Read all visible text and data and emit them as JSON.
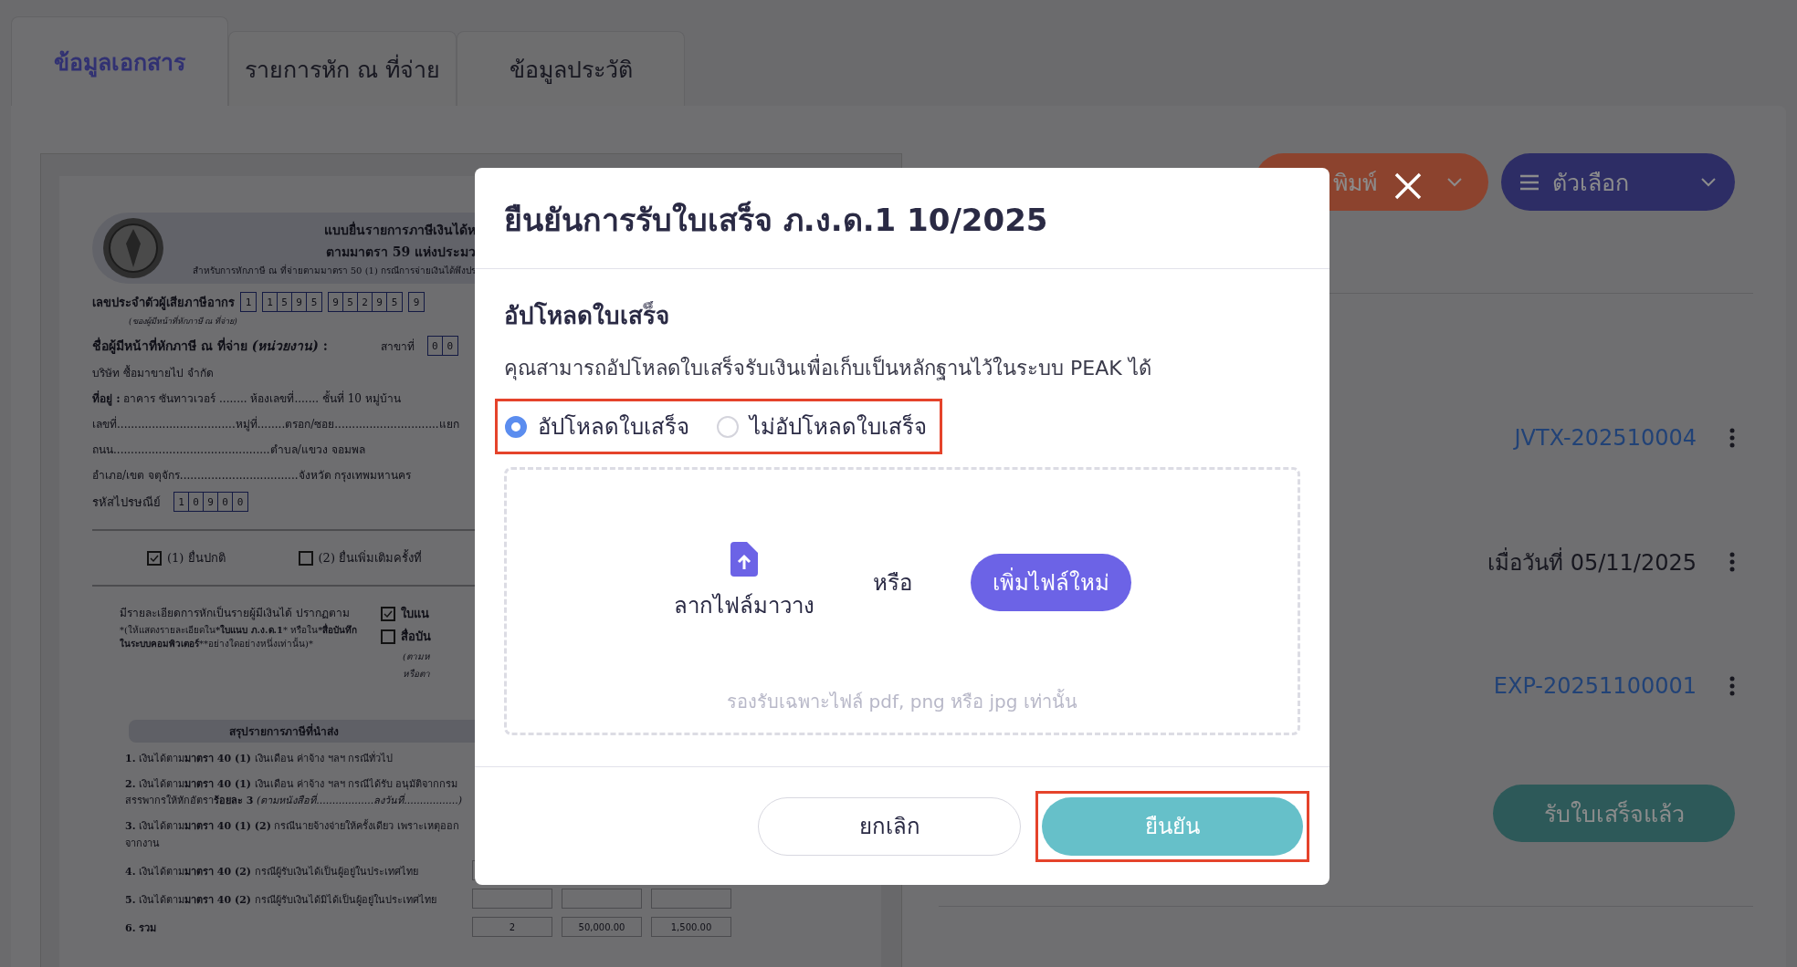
{
  "tabs": [
    {
      "label": "ข้อมูลเอกสาร",
      "selected": true
    },
    {
      "label": "รายการหัก ณ ที่จ่าย",
      "selected": false
    },
    {
      "label": "ข้อมูลประวัติ",
      "selected": false
    }
  ],
  "document": {
    "header": [
      "แบบยื่นรายการภาษีเงินได้ห",
      "ตามมาตรา 59 แห่งประมว",
      "สำหรับการหักภาษี ณ ที่จ่ายตามมาตรา 50 (1) กรณีการจ่ายเงินได้พึงปร"
    ],
    "tax_id_label": "เลขประจำตัวผู้เสียภาษีอากร",
    "tax_id_note": "(ของผู้มีหน้าที่หักภาษี ณ ที่จ่าย)",
    "tax_id_groups": [
      [
        "1"
      ],
      [
        "1",
        "5",
        "9",
        "5"
      ],
      [
        "9",
        "5",
        "2",
        "9",
        "5"
      ],
      [
        "9"
      ]
    ],
    "payer_label": "ชื่อผู้มีหน้าที่หักภาษี ณ ที่จ่าย *(หน่วยงาน)* :",
    "branch_label": "สาขาที่",
    "branch_digits": [
      "0",
      "0"
    ],
    "payer_name": "บริษัท ซื้อมาขายไป จำกัด",
    "address_lines": [
      "**ที่อยู่ :** อาคาร ซันทาวเวอร์ ........ ห้องเลขที่....... ชั้นที่ 10 หมู่บ้าน",
      "เลขที่..................................หมู่ที่........ตรอก/ซอย..............................แยก",
      "ถนน.............................................ตำบล/แขวง จอมพล",
      "อำเภอ/เขต จตุจักร..................................จังหวัด กรุงเทพมหานคร"
    ],
    "postcode_label": "รหัสไปรษณีย์",
    "postcode_digits": [
      "1",
      "0",
      "9",
      "0",
      "0"
    ],
    "filing": [
      {
        "label": "(1) ยื่นปกติ",
        "checked": true
      },
      {
        "label": "(2)  ยื่นเพิ่มเติมครั้งที่",
        "checked": false
      }
    ],
    "detail_text": "มีรายละเอียดการหักเป็นรายผู้มีเงินได้ ปรากฏตาม",
    "detail_note": "*(ให้แสดงรายละเอียดใน***ใบแนบ ภ.ง.ด.1*** หรือใน***สื่อบันทึกในระบบคอมพิวเตอร์****อย่างใดอย่างหนึ่งเท่านั้น)*",
    "attachments": [
      {
        "label": "ใบแน",
        "checked": true
      },
      {
        "label": "สื่อบัน",
        "checked": false
      }
    ],
    "attachment_notes": [
      "(ตามห",
      "หรือตา"
    ],
    "summary_title": "สรุปรายการภาษีที่นำส่ง",
    "summary_rows": [
      {
        "text": "**1.** เงินได้ตาม**มาตรา 40 (1)** เงินเดือน ค่าจ้าง ฯลฯ กรณีทั่วไป"
      },
      {
        "text": "**2.** เงินได้ตาม**มาตรา 40 (1)** เงินเดือน ค่าจ้าง ฯลฯ กรณีได้รับ อนุมัติจากกรมสรรพากรให้หักอัตรา**ร้อยละ 3** *(ตามหนังสือที่..................ลงวันที่.................)*"
      },
      {
        "text": "**3.** เงินได้ตาม**มาตรา 40 (1) (2)** กรณีนายจ้างจ่ายให้ครั้งเดียว เพราะเหตุออกจากงาน"
      },
      {
        "text": "**4.** เงินได้ตาม**มาตรา 40 (2)** กรณีผู้รับเงินได้เป็นผู้อยู่ในประเทศไทย",
        "cells": [
          "",
          "",
          ""
        ]
      },
      {
        "text": "**5.** เงินได้ตาม**มาตรา 40 (2)** กรณีผู้รับเงินได้มิได้เป็นผู้อยู่ในประเทศไทย",
        "cells": [
          "",
          "",
          ""
        ]
      },
      {
        "text": "**6. รวม**",
        "cells": [
          "2",
          "50,000.00",
          "1,500.00"
        ]
      }
    ]
  },
  "actions": [
    {
      "label": "พิมพ์",
      "kind": "print"
    },
    {
      "label": "ตัวเลือก",
      "kind": "options"
    }
  ],
  "rows": [
    {
      "value": "JVTX-202510004",
      "kind": "link"
    },
    {
      "value": "เมื่อวันที่ 05/11/2025",
      "kind": "text"
    },
    {
      "value": "EXP-20251100001",
      "kind": "link"
    }
  ],
  "received_button": "รับใบเสร็จแล้ว",
  "dialog": {
    "title": "ยืนยันการรับใบเสร็จ ภ.ง.ด.1 10/2025",
    "section_title": "อัปโหลดใบเสร็จ",
    "description": "คุณสามารถอัปโหลดใบเสร็จรับเงินเพื่อเก็บเป็นหลักฐานไว้ในระบบ PEAK ได้",
    "options_highlighted": true,
    "options": [
      {
        "label": "อัปโหลดใบเสร็จ",
        "selected": true
      },
      {
        "label": "ไม่อัปโหลดใบเสร็จ",
        "selected": false
      }
    ],
    "drop_label": "ลากไฟล์มาวาง",
    "or_text": "หรือ",
    "add_file_button": "เพิ่มไฟล์ใหม่",
    "hint": "รองรับเฉพาะไฟล์ pdf, png หรือ jpg เท่านั้น",
    "cancel_button": "ยกเลิก",
    "confirm_button": "ยืนยัน",
    "confirm_highlighted": true
  }
}
